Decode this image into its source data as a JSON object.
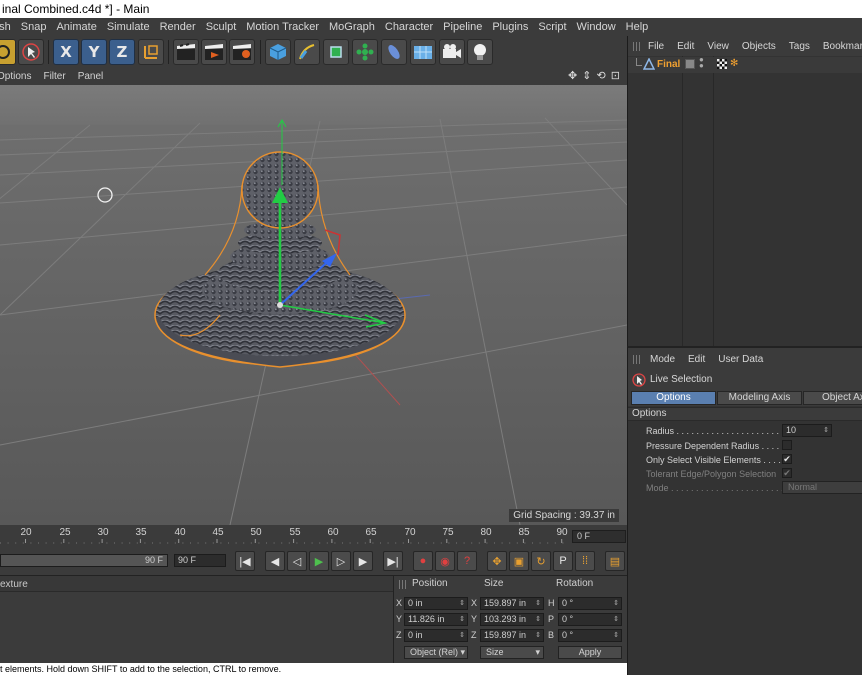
{
  "window": {
    "title": "inal Combined.c4d *] - Main"
  },
  "menu": [
    "esh",
    "Snap",
    "Animate",
    "Simulate",
    "Render",
    "Sculpt",
    "Motion Tracker",
    "MoGraph",
    "Character",
    "Pipeline",
    "Plugins",
    "Script",
    "Window",
    "Help"
  ],
  "toolbar": {
    "axis_x": "X",
    "axis_y": "Y",
    "axis_z": "Z"
  },
  "viewport": {
    "menu": [
      "Options",
      "Filter",
      "Panel"
    ],
    "nav_icons": "✥ ⇕ ⟲ ⊡",
    "grid_spacing": "Grid Spacing : 39.37 in"
  },
  "timeline": {
    "ticks": [
      "20",
      "25",
      "30",
      "35",
      "40",
      "45",
      "50",
      "55",
      "60",
      "65",
      "70",
      "75",
      "80",
      "85",
      "90"
    ],
    "current_frame": "0 F",
    "end_frame_slider": "90 F",
    "end_frame": "90 F"
  },
  "materials": {
    "header": "exture"
  },
  "coords": {
    "headers": {
      "position": "Position",
      "size": "Size",
      "rotation": "Rotation"
    },
    "rows": [
      {
        "axis": "X",
        "pos": "0 in",
        "size_axis": "X",
        "size": "159.897 in",
        "rot_axis": "H",
        "rot": "0 °"
      },
      {
        "axis": "Y",
        "pos": "11.826 in",
        "size_axis": "Y",
        "size": "103.293 in",
        "rot_axis": "P",
        "rot": "0 °"
      },
      {
        "axis": "Z",
        "pos": "0 in",
        "size_axis": "Z",
        "size": "159.897 in",
        "rot_axis": "B",
        "rot": "0 °"
      }
    ],
    "mode": "Object (Rel)",
    "size_mode": "Size",
    "apply": "Apply"
  },
  "status": "t elements. Hold down SHIFT to add to the selection, CTRL to remove.",
  "object_manager": {
    "menu": [
      "File",
      "Edit",
      "View",
      "Objects",
      "Tags",
      "Bookmarks"
    ],
    "object_name": "Final"
  },
  "attribute_manager": {
    "menu": [
      "Mode",
      "Edit",
      "User Data"
    ],
    "tool_name": "Live Selection",
    "tabs": [
      "Options",
      "Modeling Axis",
      "Object Axis"
    ],
    "section": "Options",
    "props": {
      "radius_label": "Radius . . . . . . . . . . . . . . . . . . . . . . .",
      "radius_value": "10",
      "pressure_label": "Pressure Dependent Radius . . . .",
      "visible_label": "Only Select Visible Elements . . . .",
      "tolerant_label": "Tolerant Edge/Polygon Selection",
      "mode_label": "Mode . . . . . . . . . . . . . . . . . . . . . . . .",
      "mode_value": "Normal",
      "check_mark": "✔"
    }
  },
  "colors": {
    "accent": "#5a7fb0",
    "selection": "#f0a030",
    "axis_x": "#cc3333",
    "axis_y": "#22cc44",
    "axis_z": "#3366ee"
  }
}
